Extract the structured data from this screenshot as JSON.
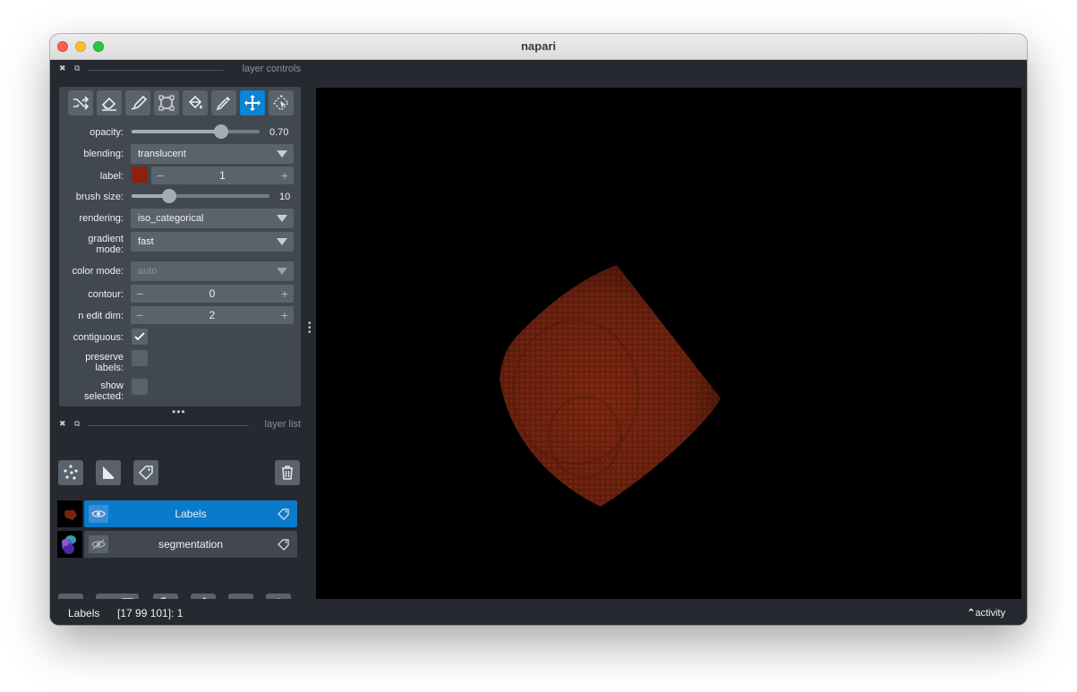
{
  "window": {
    "title": "napari"
  },
  "layer_controls": {
    "title": "layer controls",
    "tools": [
      {
        "icon": "shuffle-icon",
        "active": false
      },
      {
        "icon": "eraser-icon",
        "active": false
      },
      {
        "icon": "paintbrush-icon",
        "active": false
      },
      {
        "icon": "transform-icon",
        "active": false
      },
      {
        "icon": "fill-bucket-icon",
        "active": false
      },
      {
        "icon": "color-picker-icon",
        "active": false
      },
      {
        "icon": "pan-zoom-icon",
        "active": true
      },
      {
        "icon": "select-icon",
        "active": false
      }
    ],
    "opacity": {
      "label": "opacity:",
      "value": "0.70",
      "fraction": 0.7
    },
    "blending": {
      "label": "blending:",
      "value": "translucent"
    },
    "label": {
      "label": "label:",
      "value": "1",
      "swatch": "#8b2209"
    },
    "brush_size": {
      "label": "brush size:",
      "value": "10",
      "fraction": 0.27
    },
    "rendering": {
      "label": "rendering:",
      "value": "iso_categorical"
    },
    "gradient_mode": {
      "label_line1": "gradient",
      "label_line2": "mode:",
      "value": "fast"
    },
    "color_mode": {
      "label": "color mode:",
      "value": "auto"
    },
    "contour": {
      "label": "contour:",
      "value": "0"
    },
    "n_edit_dim": {
      "label": "n edit dim:",
      "value": "2"
    },
    "contiguous": {
      "label": "contiguous:",
      "checked": true
    },
    "preserve_labels": {
      "label_line1": "preserve",
      "label_line2": "labels:",
      "checked": false
    },
    "show_selected": {
      "label_line1": "show",
      "label_line2": "selected:",
      "checked": false
    }
  },
  "layer_list": {
    "title": "layer list",
    "layers": [
      {
        "name": "Labels",
        "selected": true,
        "visible": true
      },
      {
        "name": "segmentation",
        "selected": false,
        "visible": false
      }
    ]
  },
  "status": {
    "layer": "Labels",
    "coords": "[17 99 101]: 1",
    "activity": "activity"
  },
  "colors": {
    "accent": "#0a7acb",
    "label_color": "#7a2410",
    "panel": "#414851",
    "background": "#262930"
  }
}
